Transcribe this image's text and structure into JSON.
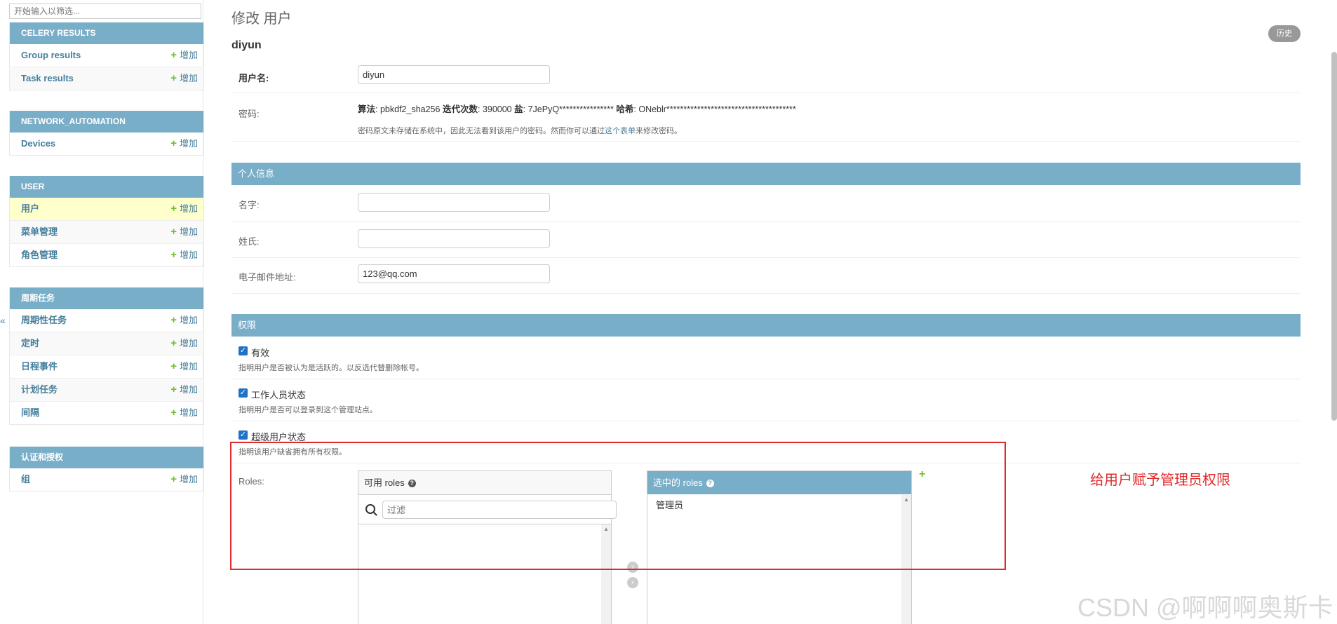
{
  "sidebar": {
    "search_placeholder": "开始输入以筛选...",
    "collapse_glyph": "«",
    "modules": [
      {
        "title": "CELERY RESULTS",
        "items": [
          {
            "label": "Group results",
            "add": "增加"
          },
          {
            "label": "Task results",
            "add": "增加"
          }
        ]
      },
      {
        "title": "NETWORK_AUTOMATION",
        "items": [
          {
            "label": "Devices",
            "add": "增加"
          }
        ]
      },
      {
        "title": "USER",
        "items": [
          {
            "label": "用户",
            "add": "增加"
          },
          {
            "label": "菜单管理",
            "add": "增加"
          },
          {
            "label": "角色管理",
            "add": "增加"
          }
        ]
      },
      {
        "title": "周期任务",
        "items": [
          {
            "label": "周期性任务",
            "add": "增加"
          },
          {
            "label": "定时",
            "add": "增加"
          },
          {
            "label": "日程事件",
            "add": "增加"
          },
          {
            "label": "计划任务",
            "add": "增加"
          },
          {
            "label": "间隔",
            "add": "增加"
          }
        ]
      },
      {
        "title": "认证和授权",
        "items": [
          {
            "label": "组",
            "add": "增加"
          }
        ]
      }
    ]
  },
  "main": {
    "title": "修改 用户",
    "object_name": "diyun",
    "history_label": "历史",
    "username_label": "用户名:",
    "username_value": "diyun",
    "password_label": "密码:",
    "password": {
      "algo_label": "算法",
      "algo_value": "pbkdf2_sha256",
      "iter_label": "迭代次数",
      "iter_value": "390000",
      "salt_label": "盐",
      "salt_value": "7JePyQ****************",
      "hash_label": "哈希",
      "hash_value": "ONeblr**************************************",
      "help_before": "密码原文未存储在系统中，因此无法看到该用户的密码。然而你可以通过",
      "help_link": "这个表单",
      "help_after": "来修改密码。"
    },
    "personal_caption": "个人信息",
    "first_name_label": "名字:",
    "first_name_value": "",
    "last_name_label": "姓氏:",
    "last_name_value": "",
    "email_label": "电子邮件地址:",
    "email_value": "123@qq.com",
    "perm_caption": "权限",
    "active_label": "有效",
    "active_help": "指明用户是否被认为是活跃的。以反选代替删除帐号。",
    "staff_label": "工作人员状态",
    "staff_help": "指明用户是否可以登录到这个管理站点。",
    "super_label": "超级用户状态",
    "super_help": "指明该用户缺省拥有所有权限。",
    "roles_label": "Roles:",
    "available_title": "可用 roles",
    "filter_placeholder": "过滤",
    "chosen_title": "选中的 roles",
    "chosen_items": [
      "管理员"
    ],
    "add_plus": "+"
  },
  "annotation": {
    "text": "给用户赋予管理员权限",
    "color": "#e02b2b"
  },
  "watermark": "CSDN @啊啊啊奥斯卡",
  "colors": {
    "header": "#79aec8",
    "link": "#447e9b",
    "add_green": "#70bf2b",
    "checkbox": "#1e73c8",
    "active_row": "#ffffcc"
  }
}
